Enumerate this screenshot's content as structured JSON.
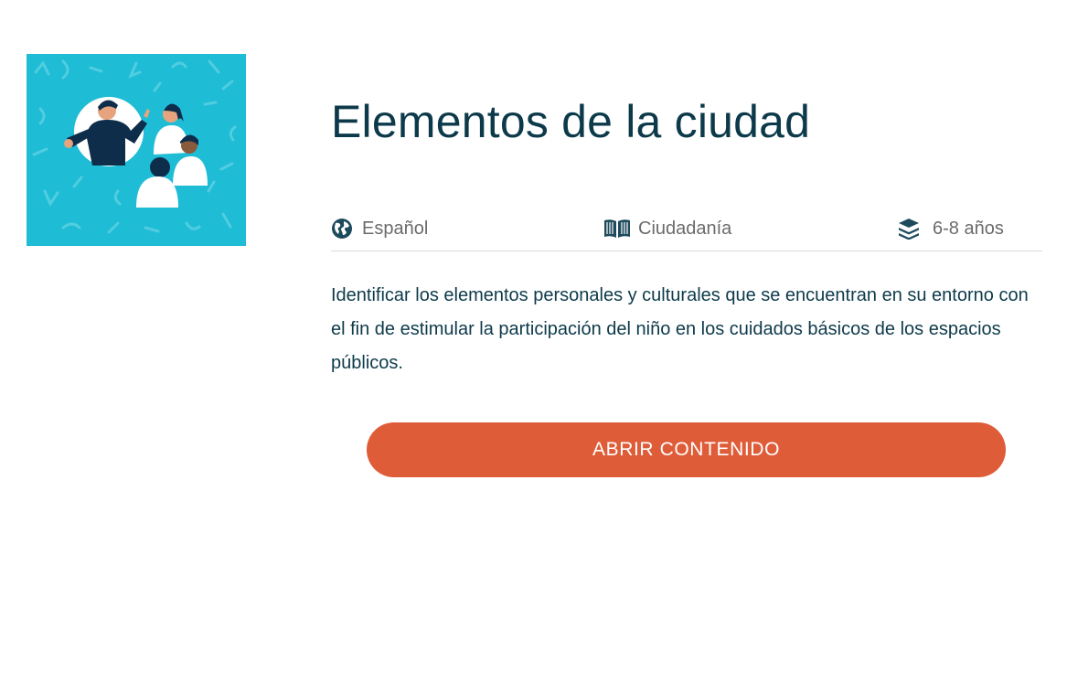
{
  "thumbnail": {
    "icon": "people-talking-illustration",
    "background_color": "#1fbcd6"
  },
  "title": "Elementos de la ciudad",
  "meta": {
    "language": {
      "icon": "globe-icon",
      "label": "Español"
    },
    "subject": {
      "icon": "book-open-icon",
      "label": "Ciudadanía"
    },
    "age": {
      "icon": "layers-icon",
      "label": "6-8 años"
    }
  },
  "description": "Identificar los elementos personales y culturales que se encuentran en su entorno con el fin de estimular la participación del niño en los cuidados básicos de los espacios públicos.",
  "open_button": {
    "label": "ABRIR CONTENIDO",
    "color": "#df5c38"
  },
  "colors": {
    "text_dark": "#0d3a4a",
    "text_muted": "#6b6b6b"
  }
}
